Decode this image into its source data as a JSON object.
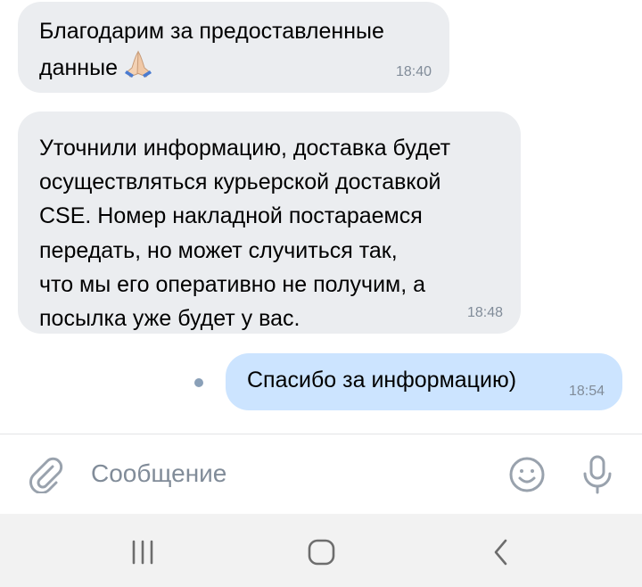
{
  "messages": [
    {
      "direction": "incoming",
      "text": "Благодарим за предоставленные\nданные",
      "emoji": "praying-hands-emoji",
      "time": "18:40"
    },
    {
      "direction": "incoming",
      "text": "Уточнили информацию, доставка будет\nосуществляться курьерской доставкой\nCSE. Номер накладной постараемся\nпередать, но может случиться так,\nчто мы его оперативно не получим, а\nпосылка уже будет у вас.",
      "time": "18:48"
    },
    {
      "direction": "outgoing",
      "text": "Спасибо за информацию)",
      "time": "18:54",
      "status": "unread"
    }
  ],
  "composer": {
    "placeholder": "Сообщение",
    "icons": [
      "paperclip-icon",
      "emoji-icon",
      "microphone-icon"
    ]
  },
  "navbar": {
    "icons": [
      "recent-apps-icon",
      "home-icon",
      "back-icon"
    ]
  },
  "colors": {
    "incoming_bubble": "#ebedf0",
    "outgoing_bubble": "#cce4ff",
    "secondary_text": "#818c99",
    "unread_dot": "#8aa0b8",
    "navbar_background": "#f2f2f2"
  }
}
